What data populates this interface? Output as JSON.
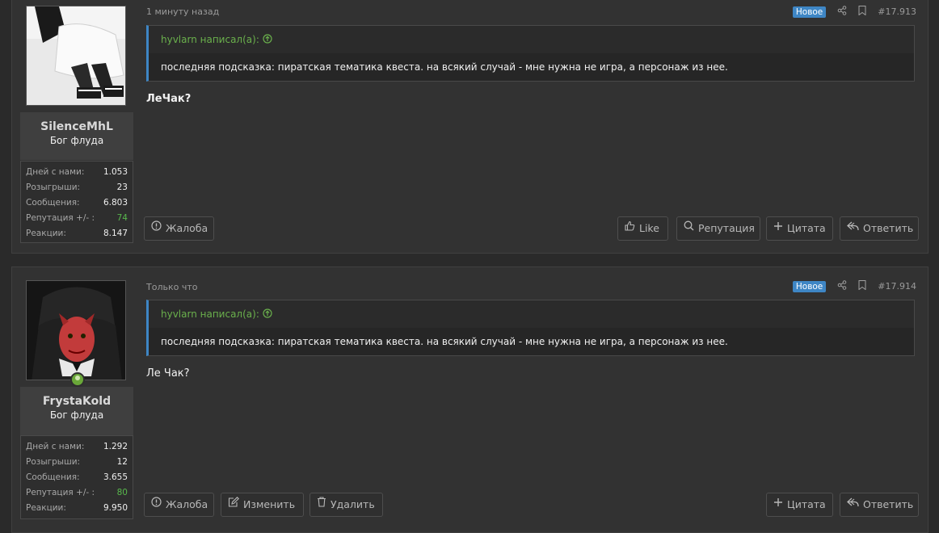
{
  "posts": [
    {
      "time": "1 минуту назад",
      "badge": "Новое",
      "number": "#17.913",
      "quote_author": "hyvlarn написал(а):",
      "quote_text": "последняя подсказка: пиратская тематика квеста. на всякий случай - мне нужна не игра, а персонаж из нее.",
      "message": "ЛеЧак?",
      "user": {
        "name": "SilenceMhL",
        "title": "Бог флуда",
        "stats": [
          {
            "label": "Дней с нами:",
            "value": "1.053"
          },
          {
            "label": "Розыгрыши:",
            "value": "23"
          },
          {
            "label": "Сообщения:",
            "value": "6.803"
          },
          {
            "label": "Репутация +/- :",
            "value": "74"
          },
          {
            "label": "Реакции:",
            "value": "8.147"
          }
        ]
      },
      "buttons": {
        "report": "Жалоба",
        "like": "Like",
        "reputation": "Репутация",
        "quote": "Цитата",
        "reply": "Ответить"
      }
    },
    {
      "time": "Только что",
      "badge": "Новое",
      "number": "#17.914",
      "quote_author": "hyvlarn написал(а):",
      "quote_text": "последняя подсказка: пиратская тематика квеста. на всякий случай - мне нужна не игра, а персонаж из нее.",
      "message": "Ле Чак?",
      "user": {
        "name": "FrystaKold",
        "title": "Бог флуда",
        "stats": [
          {
            "label": "Дней с нами:",
            "value": "1.292"
          },
          {
            "label": "Розыгрыши:",
            "value": "12"
          },
          {
            "label": "Сообщения:",
            "value": "3.655"
          },
          {
            "label": "Репутация +/- :",
            "value": "80"
          },
          {
            "label": "Реакции:",
            "value": "9.950"
          }
        ]
      },
      "buttons": {
        "report": "Жалоба",
        "edit": "Изменить",
        "delete": "Удалить",
        "quote": "Цитата",
        "reply": "Ответить"
      }
    }
  ],
  "colors": {
    "background": "#2a2a2a",
    "post_bg": "#323232",
    "badge_blue": "#3e86c5",
    "quote_author": "#6ab04c",
    "reputation_green": "#58b84c"
  },
  "icons": {
    "share": "share-icon",
    "bookmark": "bookmark-icon",
    "report": "alert-circle-icon",
    "like": "thumbs-up-icon",
    "reputation": "search-icon",
    "quote": "plus-icon",
    "reply": "reply-icon",
    "edit": "edit-icon",
    "delete": "trash-icon",
    "quote_jump": "arrow-up-circle-icon"
  }
}
